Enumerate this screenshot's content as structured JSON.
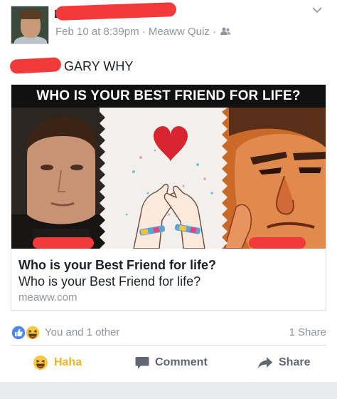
{
  "post": {
    "author_initial": "E",
    "timestamp": "Feb 10 at 8:39pm",
    "separator": "·",
    "app_name": "Meaww Quiz",
    "message": "GARY WHY"
  },
  "link": {
    "banner_text": "WHO IS YOUR BEST FRIEND FOR LIFE?",
    "title": "Who is your Best Friend for life?",
    "description": "Who is your Best Friend for life?",
    "domain": "meaww.com"
  },
  "reactions": {
    "summary": "You and 1 other",
    "share_count": "1 Share"
  },
  "actions": {
    "haha_label": "Haha",
    "comment_label": "Comment",
    "share_label": "Share"
  },
  "colors": {
    "redaction": "#f23a3a",
    "meta_gray": "#90949c",
    "haha_yellow": "#f0b429",
    "like_blue": "#4d87f4",
    "heart_red": "#d9252f"
  },
  "icons": {
    "privacy": "people-icon",
    "menu": "chevron-down-icon",
    "like_reaction": "like-icon",
    "haha_reaction": "haha-icon",
    "comment": "comment-icon",
    "share": "share-arrow-icon",
    "heart": "heart-icon"
  }
}
